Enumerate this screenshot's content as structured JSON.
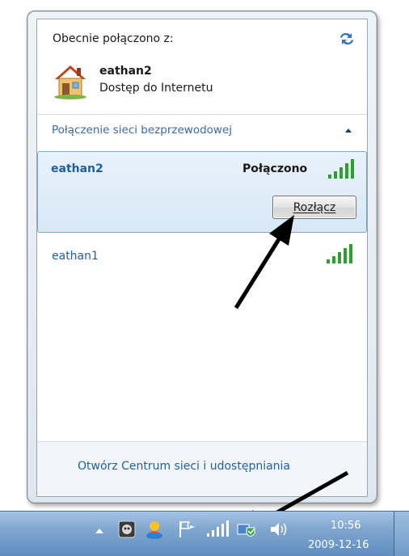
{
  "popup": {
    "currently_connected_label": "Obecnie połączono z:",
    "current_network": {
      "name": "eathan2",
      "status": "Dostęp do Internetu"
    },
    "section_header": "Połączenie sieci bezprzewodowej",
    "networks": [
      {
        "name": "eathan2",
        "status": "Połączono",
        "signal_bars": 5,
        "selected": true,
        "button_label": "Rozłącz"
      },
      {
        "name": "eathan1",
        "status": "",
        "signal_bars": 5,
        "selected": false
      }
    ],
    "footer_link": "Otwórz Centrum sieci i udostępniania"
  },
  "taskbar": {
    "time": "10:56",
    "date": "2009-12-16",
    "tray_icons": [
      "show-hidden-icons-arrow",
      "antivirus-icon",
      "weather-icon",
      "action-center-flag-icon",
      "wireless-signal-icon",
      "network-shield-icon",
      "volume-icon"
    ]
  },
  "colors": {
    "link_blue": "#1f5f9f",
    "selected_row_bg": "#dcebf7",
    "signal_green": "#2e9e2e",
    "taskbar_blue": "#7fa6cf"
  }
}
